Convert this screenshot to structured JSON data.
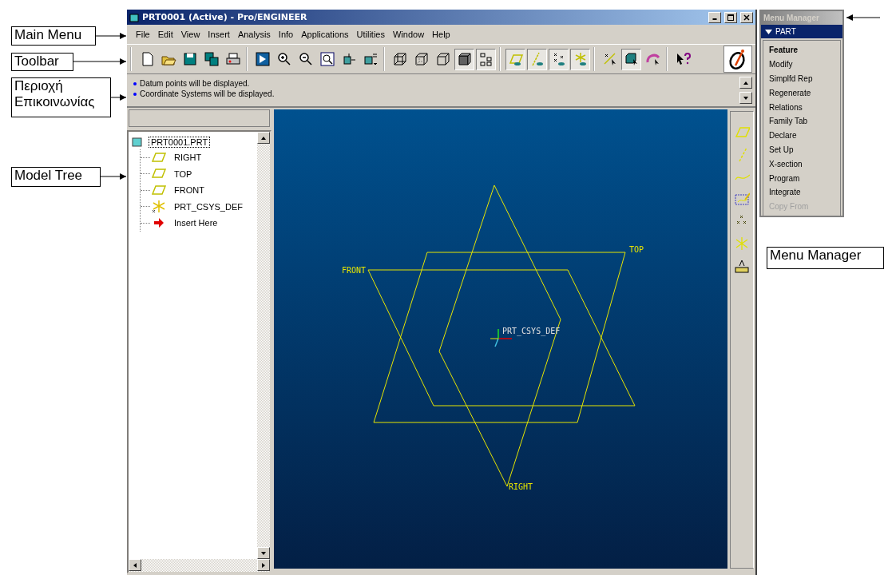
{
  "window": {
    "title": "PRT0001 (Active) - Pro/ENGINEER"
  },
  "menu_bar": [
    {
      "label": "File"
    },
    {
      "label": "Edit"
    },
    {
      "label": "View"
    },
    {
      "label": "Insert"
    },
    {
      "label": "Analysis"
    },
    {
      "label": "Info"
    },
    {
      "label": "Applications"
    },
    {
      "label": "Utilities"
    },
    {
      "label": "Window"
    },
    {
      "label": "Help"
    }
  ],
  "toolbar": [
    [
      {
        "kind": "new",
        "pressed": false
      },
      {
        "kind": "open",
        "pressed": false
      },
      {
        "kind": "save",
        "pressed": false
      },
      {
        "kind": "save-copy",
        "pressed": false
      },
      {
        "kind": "print",
        "pressed": false
      }
    ],
    [
      {
        "kind": "repaint",
        "pressed": false
      },
      {
        "kind": "zoom-in",
        "pressed": false
      },
      {
        "kind": "zoom-out",
        "pressed": false
      },
      {
        "kind": "refit",
        "pressed": false
      },
      {
        "kind": "orient",
        "pressed": false
      },
      {
        "kind": "views",
        "pressed": false
      }
    ],
    [
      {
        "kind": "wireframe",
        "pressed": false
      },
      {
        "kind": "hidden",
        "pressed": false
      },
      {
        "kind": "no-hidden",
        "pressed": false
      },
      {
        "kind": "shaded",
        "pressed": true
      },
      {
        "kind": "tree",
        "pressed": true
      }
    ],
    [
      {
        "kind": "plane-display",
        "pressed": true
      },
      {
        "kind": "axis-display",
        "pressed": true
      },
      {
        "kind": "point-display",
        "pressed": true
      },
      {
        "kind": "csys-display",
        "pressed": true
      }
    ],
    [
      {
        "kind": "spin-center",
        "pressed": false
      },
      {
        "kind": "select",
        "pressed": true
      },
      {
        "kind": "spin",
        "pressed": false
      }
    ],
    [
      {
        "kind": "help",
        "pressed": false
      }
    ]
  ],
  "messages": [
    "Datum points will be displayed.",
    "Coordinate Systems will be displayed."
  ],
  "model_tree": {
    "label": "PRT0001.PRT",
    "selected": true,
    "children": [
      {
        "label": "RIGHT",
        "kind": "plane"
      },
      {
        "label": "TOP",
        "kind": "plane"
      },
      {
        "label": "FRONT",
        "kind": "plane"
      },
      {
        "label": "PRT_CSYS_DEF",
        "kind": "csys"
      },
      {
        "label": "Insert Here",
        "kind": "insert"
      }
    ]
  },
  "viewport": {
    "datums": [
      {
        "label": "FRONT",
        "kind": "plane"
      },
      {
        "label": "TOP",
        "kind": "plane"
      },
      {
        "label": "RIGHT",
        "kind": "plane"
      },
      {
        "label": "PRT_CSYS_DEF",
        "kind": "csys"
      }
    ]
  },
  "datum_toolbar": [
    {
      "kind": "plane"
    },
    {
      "kind": "axis"
    },
    {
      "kind": "curve"
    },
    {
      "kind": "sketch"
    },
    {
      "kind": "point"
    },
    {
      "kind": "csys"
    },
    {
      "kind": "analysis"
    }
  ],
  "menu_manager": {
    "title": "Menu Manager",
    "menu": {
      "title": "PART",
      "expanded": true
    },
    "items": [
      {
        "label": "Feature",
        "selected": true,
        "disabled": false
      },
      {
        "label": "Modify",
        "selected": false,
        "disabled": false
      },
      {
        "label": "Simplfd Rep",
        "selected": false,
        "disabled": false
      },
      {
        "label": "Regenerate",
        "selected": false,
        "disabled": false
      },
      {
        "label": "Relations",
        "selected": false,
        "disabled": false
      },
      {
        "label": "Family Tab",
        "selected": false,
        "disabled": false
      },
      {
        "label": "Declare",
        "selected": false,
        "disabled": false
      },
      {
        "label": "Set Up",
        "selected": false,
        "disabled": false
      },
      {
        "label": "X-section",
        "selected": false,
        "disabled": false
      },
      {
        "label": "Program",
        "selected": false,
        "disabled": false
      },
      {
        "label": "Integrate",
        "selected": false,
        "disabled": false
      },
      {
        "label": "Copy From",
        "selected": false,
        "disabled": true
      }
    ]
  },
  "annotations": [
    {
      "text": "Main Menu"
    },
    {
      "text": "Toolbar"
    },
    {
      "text": "Περιοχή Επικοινωνίας"
    },
    {
      "text": "Model Tree"
    },
    {
      "text": "Menu Manager"
    }
  ]
}
